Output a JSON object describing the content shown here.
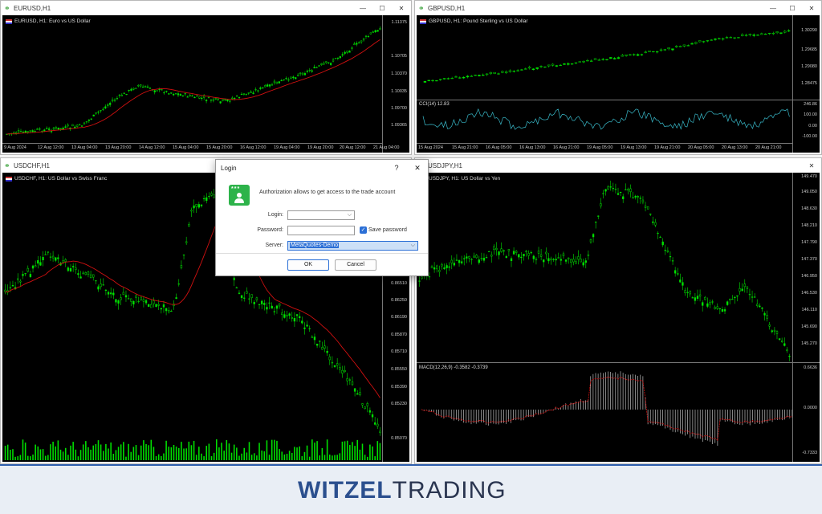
{
  "windows": {
    "eurusd": {
      "title": "EURUSD,H1",
      "label": "EURUSD, H1:  Euro vs US Dollar",
      "prices": [
        "1.11375",
        "1.10705",
        "1.10370",
        "1.10035",
        "1.09700",
        "1.09365"
      ],
      "times": [
        "9 Aug 2024",
        "12 Aug 12:00",
        "13 Aug 04:00",
        "13 Aug 20:00",
        "14 Aug 12:00",
        "15 Aug 04:00",
        "15 Aug 20:00",
        "16 Aug 12:00",
        "19 Aug 04:00",
        "19 Aug 20:00",
        "20 Aug 12:00",
        "21 Aug 04:00"
      ]
    },
    "gbpusd": {
      "title": "GBPUSD,H1",
      "label": "GBPUSD, H1:  Pound Sterling vs US Dollar",
      "prices": [
        "1.30290",
        "1.29685",
        "1.29080",
        "1.28475"
      ],
      "indicator_label": "CCI(14) 12.83",
      "indicator_values": [
        "246.86",
        "100.00",
        "0.00",
        "-100.00"
      ],
      "times": [
        "15 Aug 2024",
        "15 Aug 21:00",
        "16 Aug 05:00",
        "16 Aug 13:00",
        "16 Aug 21:00",
        "19 Aug 05:00",
        "19 Aug 13:00",
        "19 Aug 21:00",
        "20 Aug 05:00",
        "20 Aug 13:00",
        "20 Aug 21:00"
      ]
    },
    "usdchf": {
      "title": "USDCHF,H1",
      "label": "USDCHF, H1:  US Dollar vs Swiss Franc",
      "prices": [
        "0.86510",
        "0.86250",
        "0.86190",
        "0.85870",
        "0.85710",
        "0.85550",
        "0.85390",
        "0.85230",
        "0.85070"
      ]
    },
    "usdjpy": {
      "title": "USDJPY,H1",
      "label": "USDJPY, H1:  US Dollar vs Yen",
      "prices": [
        "149.470",
        "149.050",
        "148.630",
        "148.210",
        "147.790",
        "147.370",
        "146.950",
        "146.530",
        "146.110",
        "145.690",
        "145.270"
      ],
      "indicator_label": "MACD(12,26,9) -0.3582 -0.3739",
      "indicator_values": [
        "0.6636",
        "0.0000",
        "-0.7333"
      ]
    }
  },
  "login_dialog": {
    "title": "Login",
    "help": "?",
    "close": "✕",
    "description": "Authorization allows to get access to the trade account",
    "login_label": "Login:",
    "login_value": "",
    "password_label": "Password:",
    "password_value": "",
    "save_password_label": "Save password",
    "server_label": "Server:",
    "server_value": "MetaQuotes-Demo",
    "ok_label": "OK",
    "cancel_label": "Cancel"
  },
  "brand": {
    "first": "WITZEL",
    "second": "TRADING"
  },
  "colors": {
    "candle_bull": "#00e000",
    "ma_line": "#d01010",
    "cci_line": "#38b8c8",
    "accent": "#2b6fd6"
  }
}
